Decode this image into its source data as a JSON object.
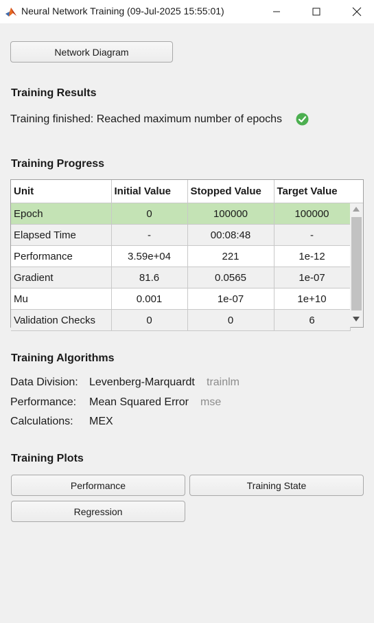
{
  "window": {
    "title": "Neural Network Training (09-Jul-2025 15:55:01)",
    "accent": "#c4e3b5",
    "success_color": "#4caf50"
  },
  "network_diagram_button": "Network Diagram",
  "results": {
    "heading": "Training Results",
    "status": "Training finished: Reached maximum number of epochs"
  },
  "progress": {
    "heading": "Training Progress",
    "columns": [
      "Unit",
      "Initial Value",
      "Stopped Value",
      "Target Value"
    ],
    "rows": [
      {
        "unit": "Epoch",
        "initial": "0",
        "stopped": "100000",
        "target": "100000"
      },
      {
        "unit": "Elapsed Time",
        "initial": "-",
        "stopped": "00:08:48",
        "target": "-"
      },
      {
        "unit": "Performance",
        "initial": "3.59e+04",
        "stopped": "221",
        "target": "1e-12"
      },
      {
        "unit": "Gradient",
        "initial": "81.6",
        "stopped": "0.0565",
        "target": "1e-07"
      },
      {
        "unit": "Mu",
        "initial": "0.001",
        "stopped": "1e-07",
        "target": "1e+10"
      },
      {
        "unit": "Validation Checks",
        "initial": "0",
        "stopped": "0",
        "target": "6"
      }
    ]
  },
  "algorithms": {
    "heading": "Training Algorithms",
    "data_division_label": "Data Division:",
    "data_division_value": "Levenberg-Marquardt",
    "data_division_code": "trainlm",
    "performance_label": "Performance:",
    "performance_value": "Mean Squared Error",
    "performance_code": "mse",
    "calculations_label": "Calculations:",
    "calculations_value": "MEX"
  },
  "plots": {
    "heading": "Training Plots",
    "performance_button": "Performance",
    "training_state_button": "Training State",
    "regression_button": "Regression"
  }
}
